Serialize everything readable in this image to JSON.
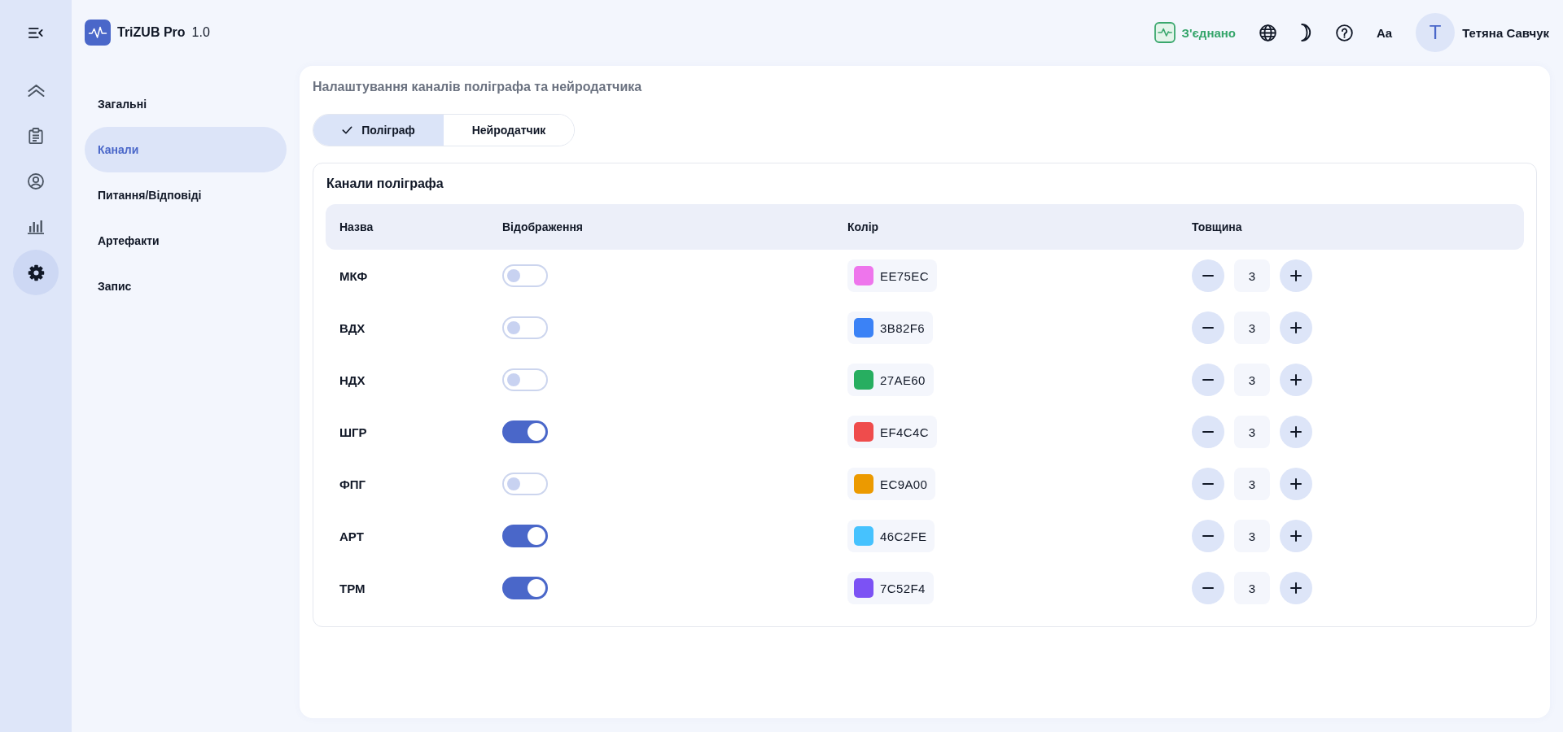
{
  "rail": {
    "items": [
      {
        "selected": false
      },
      {
        "selected": false
      },
      {
        "selected": false
      },
      {
        "selected": false
      },
      {
        "selected": true
      }
    ]
  },
  "header": {
    "app_name": "TriZUB Pro",
    "version": "1.0",
    "status": "З'єднано",
    "font_button": "Aa",
    "user": {
      "initial": "Т",
      "name": "Тетяна Савчук"
    }
  },
  "settings_nav": {
    "items": [
      {
        "label": "Загальні",
        "selected": false
      },
      {
        "label": "Канали",
        "selected": true
      },
      {
        "label": "Питання/Відповіді",
        "selected": false
      },
      {
        "label": "Артефакти",
        "selected": false
      },
      {
        "label": "Запис",
        "selected": false
      }
    ]
  },
  "page": {
    "title": "Налаштування каналів поліграфа та нейродатчика",
    "tabs": [
      {
        "label": "Поліграф",
        "selected": true
      },
      {
        "label": "Нейродатчик",
        "selected": false
      }
    ],
    "table": {
      "title": "Канали поліграфа",
      "columns": [
        "Назва",
        "Відображення",
        "Колір",
        "Товщина"
      ],
      "rows": [
        {
          "name": "МКФ",
          "visible": false,
          "color": "#ee75ec",
          "hex": "EE75EC",
          "thickness": "3"
        },
        {
          "name": "ВДХ",
          "visible": false,
          "color": "#3b82f6",
          "hex": "3B82F6",
          "thickness": "3"
        },
        {
          "name": "НДХ",
          "visible": false,
          "color": "#27ae60",
          "hex": "27AE60",
          "thickness": "3"
        },
        {
          "name": "ШГР",
          "visible": true,
          "color": "#ef4c4c",
          "hex": "EF4C4C",
          "thickness": "3"
        },
        {
          "name": "ФПГ",
          "visible": false,
          "color": "#ec9a00",
          "hex": "EC9A00",
          "thickness": "3"
        },
        {
          "name": "АРТ",
          "visible": true,
          "color": "#46c2fe",
          "hex": "46C2FE",
          "thickness": "3"
        },
        {
          "name": "ТРМ",
          "visible": true,
          "color": "#7c52f4",
          "hex": "7C52F4",
          "thickness": "3"
        }
      ]
    }
  }
}
